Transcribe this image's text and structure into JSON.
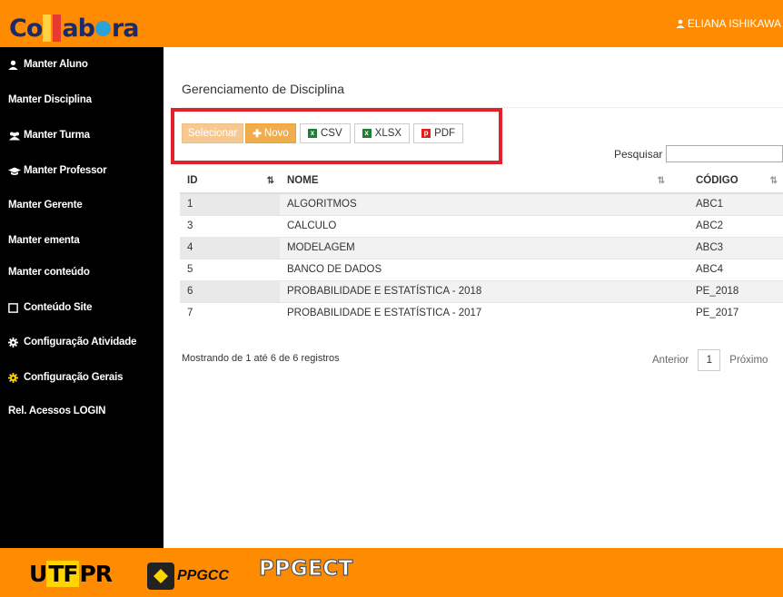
{
  "header": {
    "logo_text": "Collabora",
    "user_name": "ELIANA ISHIKAWA",
    "colors": {
      "accent": "#ff8c00",
      "sidebar": "#000000"
    }
  },
  "sidebar": {
    "items": [
      {
        "label": "Manter Aluno",
        "icon": "user-icon"
      },
      {
        "label": "Manter Disciplina",
        "icon": ""
      },
      {
        "label": "Manter Turma",
        "icon": "users-icon"
      },
      {
        "label": "Manter Professor",
        "icon": "graduation-cap-icon"
      },
      {
        "label": "Manter Gerente",
        "icon": ""
      },
      {
        "label": "Manter ementa",
        "icon": ""
      },
      {
        "label": "Manter conteúdo",
        "icon": ""
      },
      {
        "label": "Conteúdo Site",
        "icon": "square-icon"
      },
      {
        "label": "Configuração Atividade",
        "icon": "gear-icon"
      },
      {
        "label": "Configuração Gerais",
        "icon": "gear-icon"
      },
      {
        "label": "Rel. Acessos LOGIN",
        "icon": ""
      }
    ]
  },
  "main": {
    "title": "Gerenciamento de Disciplina",
    "toolbar": {
      "selecionar": "Selecionar",
      "novo": "Novo",
      "csv": "CSV",
      "xlsx": "XLSX",
      "pdf": "PDF"
    },
    "search_label": "Pesquisar",
    "search_value": "",
    "table": {
      "headers": [
        "ID",
        "NOME",
        "CÓDIGO"
      ],
      "rows": [
        [
          "1",
          "ALGORITMOS",
          "ABC1"
        ],
        [
          "3",
          "CALCULO",
          "ABC2"
        ],
        [
          "4",
          "MODELAGEM",
          "ABC3"
        ],
        [
          "5",
          "BANCO DE DADOS",
          "ABC4"
        ],
        [
          "6",
          "PROBABILIDADE E ESTATÍSTICA - 2018",
          "PE_2018"
        ],
        [
          "7",
          "PROBABILIDADE E ESTATÍSTICA - 2017",
          "PE_2017"
        ]
      ]
    },
    "info": "Mostrando de 1 até 6 de 6 registros",
    "pager": {
      "prev": "Anterior",
      "page": "1",
      "next": "Próximo"
    }
  },
  "footer": {
    "logo1": "UTFPR",
    "logo2": "PPGCC",
    "logo3": "PPGECT"
  }
}
